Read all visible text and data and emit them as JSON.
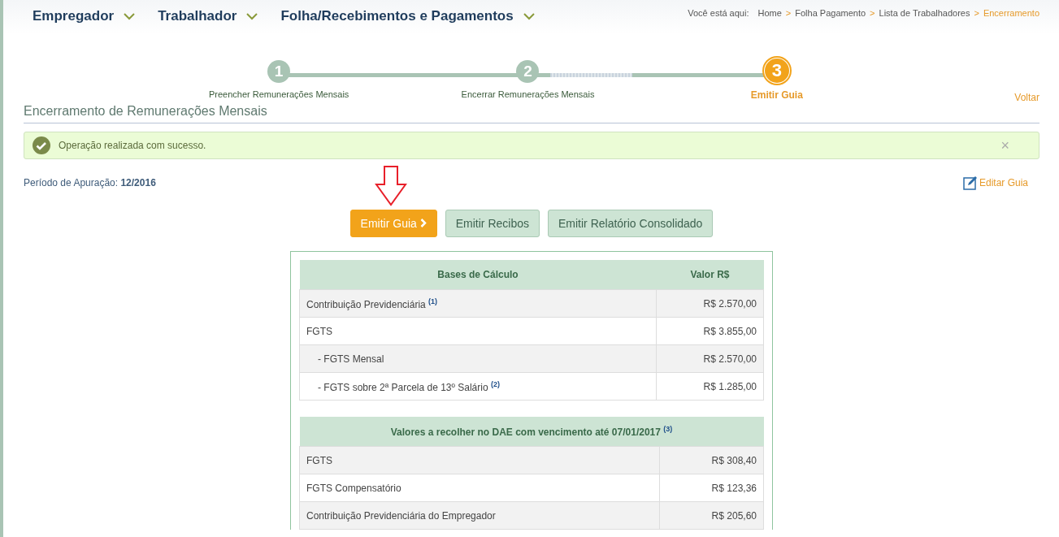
{
  "nav": {
    "menus": [
      {
        "label": "Empregador"
      },
      {
        "label": "Trabalhador"
      },
      {
        "label": "Folha/Recebimentos e Pagamentos"
      }
    ],
    "breadcrumb": {
      "prefix": "Você está aqui:",
      "items": [
        {
          "label": "Home",
          "selected": false
        },
        {
          "label": "Folha Pagamento",
          "selected": false
        },
        {
          "label": "Lista de Trabalhadores",
          "selected": false
        },
        {
          "label": "Encerramento",
          "selected": true
        }
      ],
      "separator": ">"
    }
  },
  "steps": [
    {
      "number": "1",
      "label": "Preencher Remunerações Mensais",
      "selected": false
    },
    {
      "number": "2",
      "label": "Encerrar Remunerações Mensais",
      "selected": false
    },
    {
      "number": "3",
      "label": "Emitir Guia",
      "selected": true
    }
  ],
  "back_link": "Voltar",
  "section_title": "Encerramento de Remunerações Mensais",
  "alert": {
    "message": "Operação realizada com sucesso.",
    "close": "×"
  },
  "period": {
    "label": "Período de Apuração:",
    "value": "12/2016"
  },
  "edit_link": "Editar Guia",
  "buttons": [
    {
      "label": "Emitir Guia",
      "selected": true
    },
    {
      "label": "Emitir Recibos",
      "selected": false
    },
    {
      "label": "Emitir Relatório Consolidado",
      "selected": false
    }
  ],
  "tables": [
    {
      "columns": [
        "Bases de Cálculo",
        "Valor R$"
      ],
      "rows": [
        {
          "kind": "main",
          "label": "Contribuição Previdenciária $^{(1)}$",
          "value": "R$ 2.570,00"
        },
        {
          "kind": "main",
          "label": "FGTS",
          "value": "R$ 3.855,00"
        },
        {
          "kind": "sub",
          "label": "- FGTS Mensal",
          "value": "R$ 2.570,00"
        },
        {
          "kind": "sub",
          "label": "- FGTS sobre 2ª Parcela de 13º Salário $^{(2)}$",
          "value": "R$ 1.285,00"
        }
      ]
    },
    {
      "columns": [
        "Valores a recolher no DAE com vencimento até 07/01/2017 $^{(3)}$"
      ],
      "rows": [
        {
          "kind": "main",
          "label": "FGTS",
          "value": "R$ 308,40"
        },
        {
          "kind": "main",
          "label": "FGTS Compensatório",
          "value": "R$ 123,36"
        },
        {
          "kind": "main",
          "label": "Contribuição Previdenciária do Empregador",
          "value": "R$ 205,60"
        }
      ]
    }
  ]
}
